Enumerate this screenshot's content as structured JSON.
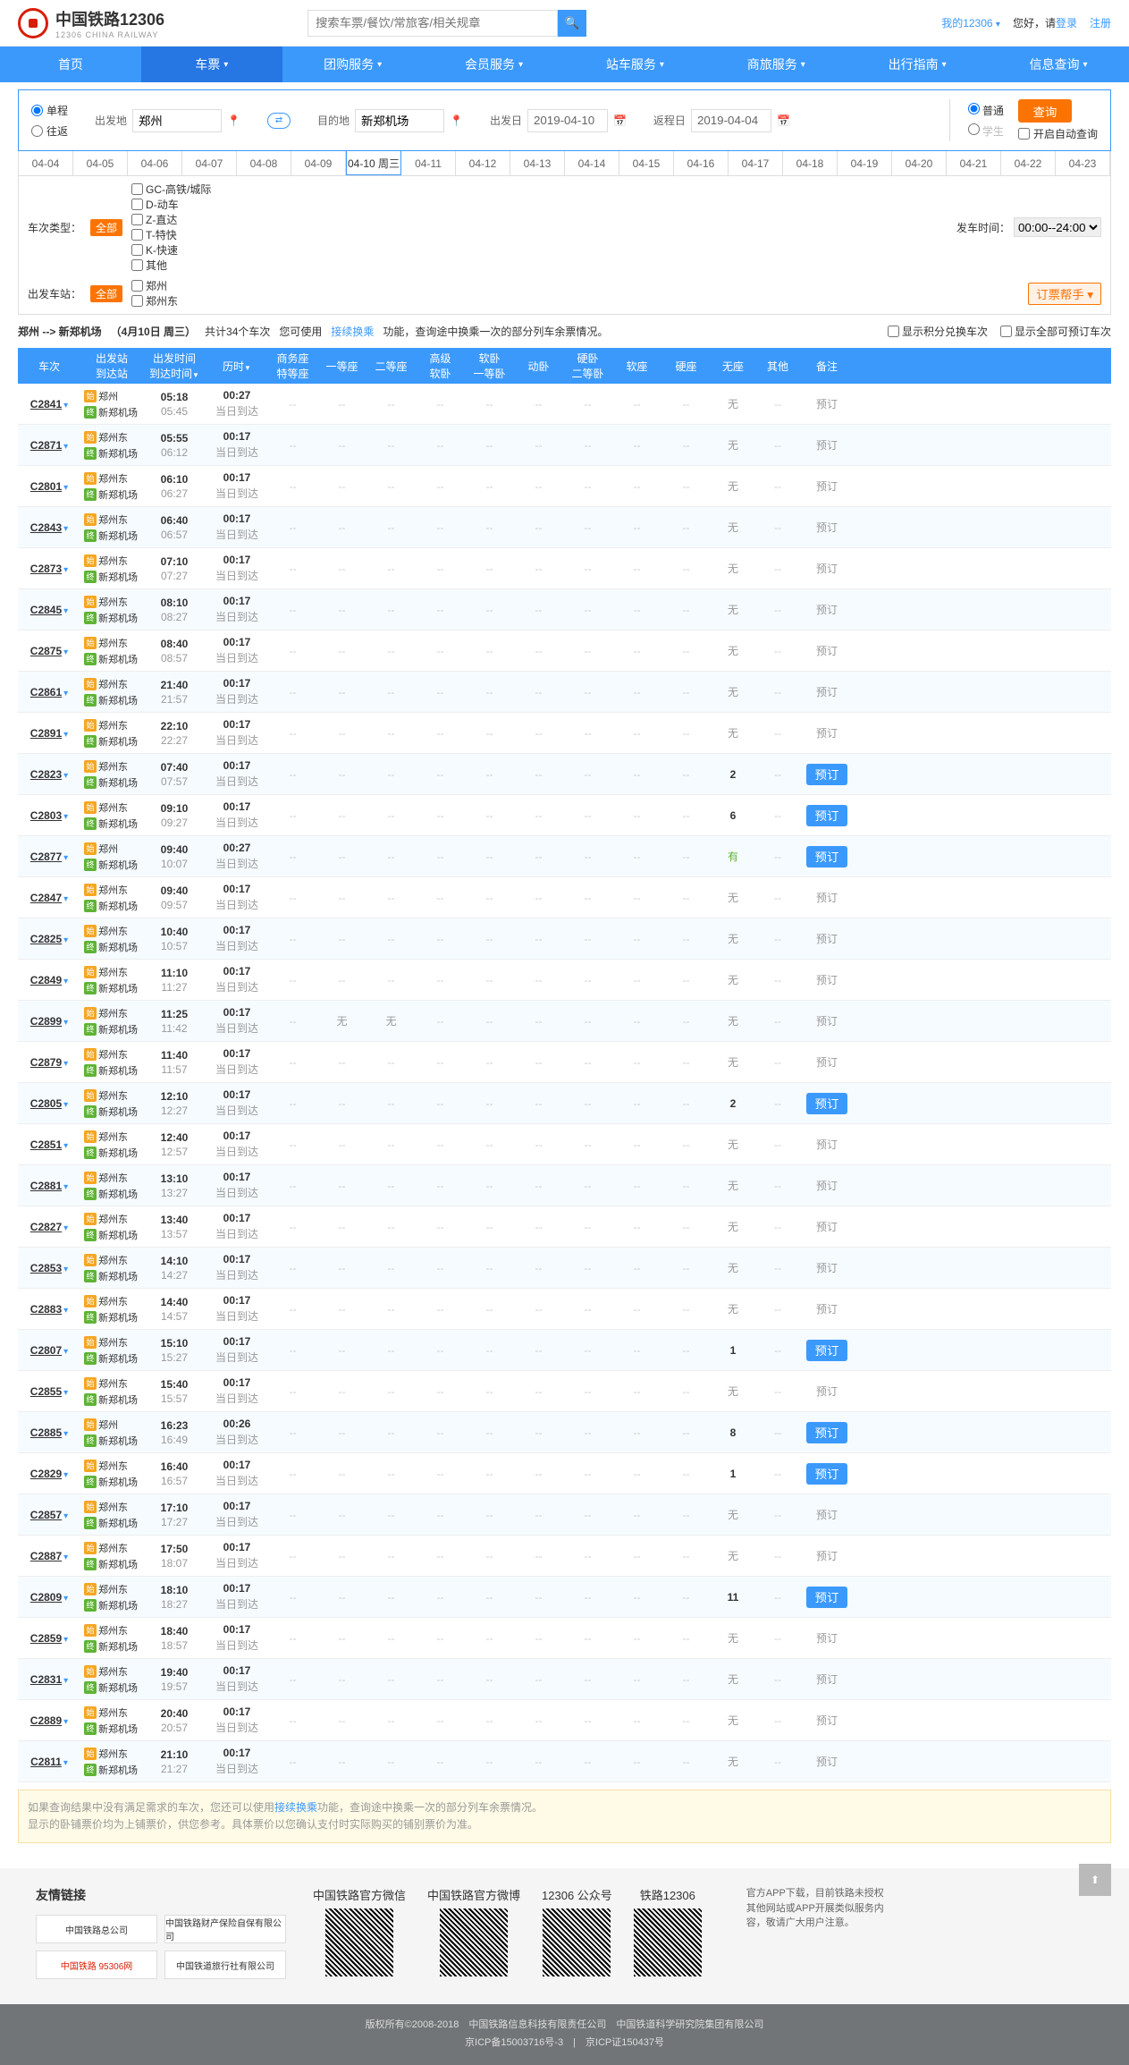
{
  "header": {
    "title": "中国铁路12306",
    "subtitle": "12306 CHINA RAILWAY",
    "search_placeholder": "搜索车票/餐饮/常旅客/相关规章",
    "my12306": "我的12306",
    "greet": "您好，请",
    "login": "登录",
    "register": "注册"
  },
  "nav": [
    "首页",
    "车票",
    "团购服务",
    "会员服务",
    "站车服务",
    "商旅服务",
    "出行指南",
    "信息查询"
  ],
  "query": {
    "oneway": "单程",
    "roundtrip": "往返",
    "from_lbl": "出发地",
    "from": "郑州",
    "to_lbl": "目的地",
    "to": "新郑机场",
    "dep_lbl": "出发日",
    "dep_date": "2019-04-10",
    "ret_lbl": "返程日",
    "ret_date": "2019-04-04",
    "normal": "普通",
    "student": "学生",
    "query_btn": "查询",
    "auto": "开启自动查询"
  },
  "dates": [
    "04-04",
    "04-05",
    "04-06",
    "04-07",
    "04-08",
    "04-09",
    "04-10 周三",
    "04-11",
    "04-12",
    "04-13",
    "04-14",
    "04-15",
    "04-16",
    "04-17",
    "04-18",
    "04-19",
    "04-20",
    "04-21",
    "04-22",
    "04-23"
  ],
  "filters": {
    "type_lbl": "车次类型：",
    "all": "全部",
    "types": [
      "GC-高铁/城际",
      "D-动车",
      "Z-直达",
      "T-特快",
      "K-快速",
      "其他"
    ],
    "station_lbl": "出发车站：",
    "stations": [
      "郑州",
      "郑州东"
    ],
    "dep_time_lbl": "发车时间：",
    "dep_time": "00:00--24:00",
    "assist": "订票帮手"
  },
  "result": {
    "route": "郑州 --> 新郑机场",
    "date": "（4月10日  周三）",
    "count": "共计34个车次",
    "tip1": "您可使用",
    "link": "接续换乘",
    "tip2": "功能，查询途中换乘一次的部分列车余票情况。",
    "opt1": "显示积分兑换车次",
    "opt2": "显示全部可预订车次"
  },
  "cols": {
    "train": "车次",
    "station": "出发站\n到达站",
    "time": "出发时间\n到达时间",
    "dur": "历时",
    "s1": "商务座\n特等座",
    "s2": "一等座",
    "s3": "二等座",
    "s4": "高级\n软卧",
    "s5": "软卧\n一等卧",
    "s6": "动卧",
    "s7": "硬卧\n二等卧",
    "s8": "软座",
    "s9": "硬座",
    "s10": "无座",
    "s11": "其他",
    "note": "备注"
  },
  "tag_start": "始",
  "tag_end": "终",
  "arrive_same": "当日到达",
  "book": "预订",
  "rows": [
    {
      "no": "C2841",
      "from": "郑州",
      "to": "新郑机场",
      "dep": "05:18",
      "arr": "05:45",
      "dur": "00:27",
      "wuz": "无",
      "book": false
    },
    {
      "no": "C2871",
      "from": "郑州东",
      "to": "新郑机场",
      "dep": "05:55",
      "arr": "06:12",
      "dur": "00:17",
      "wuz": "无",
      "book": false
    },
    {
      "no": "C2801",
      "from": "郑州东",
      "to": "新郑机场",
      "dep": "06:10",
      "arr": "06:27",
      "dur": "00:17",
      "wuz": "无",
      "book": false
    },
    {
      "no": "C2843",
      "from": "郑州东",
      "to": "新郑机场",
      "dep": "06:40",
      "arr": "06:57",
      "dur": "00:17",
      "wuz": "无",
      "book": false
    },
    {
      "no": "C2873",
      "from": "郑州东",
      "to": "新郑机场",
      "dep": "07:10",
      "arr": "07:27",
      "dur": "00:17",
      "wuz": "无",
      "book": false
    },
    {
      "no": "C2845",
      "from": "郑州东",
      "to": "新郑机场",
      "dep": "08:10",
      "arr": "08:27",
      "dur": "00:17",
      "wuz": "无",
      "book": false
    },
    {
      "no": "C2875",
      "from": "郑州东",
      "to": "新郑机场",
      "dep": "08:40",
      "arr": "08:57",
      "dur": "00:17",
      "wuz": "无",
      "book": false
    },
    {
      "no": "C2861",
      "from": "郑州东",
      "to": "新郑机场",
      "dep": "21:40",
      "arr": "21:57",
      "dur": "00:17",
      "wuz": "无",
      "book": false
    },
    {
      "no": "C2891",
      "from": "郑州东",
      "to": "新郑机场",
      "dep": "22:10",
      "arr": "22:27",
      "dur": "00:17",
      "wuz": "无",
      "book": false
    },
    {
      "no": "C2823",
      "from": "郑州东",
      "to": "新郑机场",
      "dep": "07:40",
      "arr": "07:57",
      "dur": "00:17",
      "wuz": "2",
      "book": true,
      "num": true
    },
    {
      "no": "C2803",
      "from": "郑州东",
      "to": "新郑机场",
      "dep": "09:10",
      "arr": "09:27",
      "dur": "00:17",
      "wuz": "6",
      "book": true,
      "num": true
    },
    {
      "no": "C2877",
      "from": "郑州",
      "to": "新郑机场",
      "dep": "09:40",
      "arr": "10:07",
      "dur": "00:27",
      "wuz": "有",
      "book": true,
      "you": true
    },
    {
      "no": "C2847",
      "from": "郑州东",
      "to": "新郑机场",
      "dep": "09:40",
      "arr": "09:57",
      "dur": "00:17",
      "wuz": "无",
      "book": false
    },
    {
      "no": "C2825",
      "from": "郑州东",
      "to": "新郑机场",
      "dep": "10:40",
      "arr": "10:57",
      "dur": "00:17",
      "wuz": "无",
      "book": false
    },
    {
      "no": "C2849",
      "from": "郑州东",
      "to": "新郑机场",
      "dep": "11:10",
      "arr": "11:27",
      "dur": "00:17",
      "wuz": "无",
      "book": false
    },
    {
      "no": "C2899",
      "from": "郑州东",
      "to": "新郑机场",
      "dep": "11:25",
      "arr": "11:42",
      "dur": "00:17",
      "s2": "无",
      "s3": "无",
      "s10": "无",
      "wuz": "无",
      "book": false,
      "seats": true
    },
    {
      "no": "C2879",
      "from": "郑州东",
      "to": "新郑机场",
      "dep": "11:40",
      "arr": "11:57",
      "dur": "00:17",
      "wuz": "无",
      "book": false
    },
    {
      "no": "C2805",
      "from": "郑州东",
      "to": "新郑机场",
      "dep": "12:10",
      "arr": "12:27",
      "dur": "00:17",
      "wuz": "2",
      "book": true,
      "num": true
    },
    {
      "no": "C2851",
      "from": "郑州东",
      "to": "新郑机场",
      "dep": "12:40",
      "arr": "12:57",
      "dur": "00:17",
      "wuz": "无",
      "book": false
    },
    {
      "no": "C2881",
      "from": "郑州东",
      "to": "新郑机场",
      "dep": "13:10",
      "arr": "13:27",
      "dur": "00:17",
      "wuz": "无",
      "book": false
    },
    {
      "no": "C2827",
      "from": "郑州东",
      "to": "新郑机场",
      "dep": "13:40",
      "arr": "13:57",
      "dur": "00:17",
      "wuz": "无",
      "book": false
    },
    {
      "no": "C2853",
      "from": "郑州东",
      "to": "新郑机场",
      "dep": "14:10",
      "arr": "14:27",
      "dur": "00:17",
      "wuz": "无",
      "book": false
    },
    {
      "no": "C2883",
      "from": "郑州东",
      "to": "新郑机场",
      "dep": "14:40",
      "arr": "14:57",
      "dur": "00:17",
      "wuz": "无",
      "book": false
    },
    {
      "no": "C2807",
      "from": "郑州东",
      "to": "新郑机场",
      "dep": "15:10",
      "arr": "15:27",
      "dur": "00:17",
      "wuz": "1",
      "book": true,
      "num": true
    },
    {
      "no": "C2855",
      "from": "郑州东",
      "to": "新郑机场",
      "dep": "15:40",
      "arr": "15:57",
      "dur": "00:17",
      "wuz": "无",
      "book": false
    },
    {
      "no": "C2885",
      "from": "郑州",
      "to": "新郑机场",
      "dep": "16:23",
      "arr": "16:49",
      "dur": "00:26",
      "wuz": "8",
      "book": true,
      "num": true
    },
    {
      "no": "C2829",
      "from": "郑州东",
      "to": "新郑机场",
      "dep": "16:40",
      "arr": "16:57",
      "dur": "00:17",
      "wuz": "1",
      "book": true,
      "num": true
    },
    {
      "no": "C2857",
      "from": "郑州东",
      "to": "新郑机场",
      "dep": "17:10",
      "arr": "17:27",
      "dur": "00:17",
      "wuz": "无",
      "book": false
    },
    {
      "no": "C2887",
      "from": "郑州东",
      "to": "新郑机场",
      "dep": "17:50",
      "arr": "18:07",
      "dur": "00:17",
      "wuz": "无",
      "book": false
    },
    {
      "no": "C2809",
      "from": "郑州东",
      "to": "新郑机场",
      "dep": "18:10",
      "arr": "18:27",
      "dur": "00:17",
      "wuz": "11",
      "book": true,
      "num": true
    },
    {
      "no": "C2859",
      "from": "郑州东",
      "to": "新郑机场",
      "dep": "18:40",
      "arr": "18:57",
      "dur": "00:17",
      "wuz": "无",
      "book": false
    },
    {
      "no": "C2831",
      "from": "郑州东",
      "to": "新郑机场",
      "dep": "19:40",
      "arr": "19:57",
      "dur": "00:17",
      "wuz": "无",
      "book": false
    },
    {
      "no": "C2889",
      "from": "郑州东",
      "to": "新郑机场",
      "dep": "20:40",
      "arr": "20:57",
      "dur": "00:17",
      "wuz": "无",
      "book": false
    },
    {
      "no": "C2811",
      "from": "郑州东",
      "to": "新郑机场",
      "dep": "21:10",
      "arr": "21:27",
      "dur": "00:17",
      "wuz": "无",
      "book": false
    }
  ],
  "tip": {
    "t1": "如果查询结果中没有满足需求的车次，您还可以使用",
    "link": "接续换乘",
    "t2": "功能，查询途中换乘一次的部分列车余票情况。",
    "t3": "显示的卧铺票价均为上铺票价，供您参考。具体票价以您确认支付时实际购买的铺别票价为准。"
  },
  "footer": {
    "links_title": "友情链接",
    "partners": [
      "中国铁路总公司",
      "中国铁路财产保险自保有限公司",
      "中国铁路 95306网",
      "中国铁道旅行社有限公司"
    ],
    "qr_titles": [
      "中国铁路官方微信",
      "中国铁路官方微博",
      "12306 公众号",
      "铁路12306"
    ],
    "app_note": "官方APP下载，目前铁路未授权其他网站或APP开展类似服务内容，敬请广大用户注意。",
    "copy1": "版权所有©2008-2018　中国铁路信息科技有限责任公司　中国铁道科学研究院集团有限公司",
    "copy2": "京ICP备15003716号-3　|　京ICP证150437号"
  }
}
